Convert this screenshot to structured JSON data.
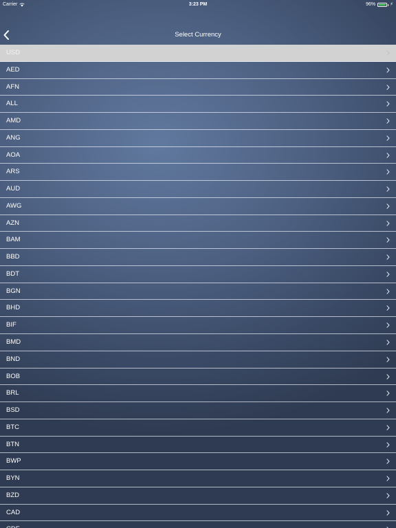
{
  "status_bar": {
    "carrier": "Carrier",
    "time": "3:23 PM",
    "battery": "96%",
    "icons": [
      "wifi-icon",
      "battery-icon",
      "bolt-icon"
    ]
  },
  "nav": {
    "title": "Select Currency",
    "back_icon": "chevron-left-icon"
  },
  "currencies": [
    {
      "code": "USD",
      "selected": true
    },
    {
      "code": "AED"
    },
    {
      "code": "AFN"
    },
    {
      "code": "ALL"
    },
    {
      "code": "AMD"
    },
    {
      "code": "ANG"
    },
    {
      "code": "AOA"
    },
    {
      "code": "ARS"
    },
    {
      "code": "AUD"
    },
    {
      "code": "AWG"
    },
    {
      "code": "AZN"
    },
    {
      "code": "BAM"
    },
    {
      "code": "BBD"
    },
    {
      "code": "BDT"
    },
    {
      "code": "BGN"
    },
    {
      "code": "BHD"
    },
    {
      "code": "BIF"
    },
    {
      "code": "BMD"
    },
    {
      "code": "BND"
    },
    {
      "code": "BOB"
    },
    {
      "code": "BRL"
    },
    {
      "code": "BSD"
    },
    {
      "code": "BTC"
    },
    {
      "code": "BTN"
    },
    {
      "code": "BWP"
    },
    {
      "code": "BYN"
    },
    {
      "code": "BZD"
    },
    {
      "code": "CAD"
    },
    {
      "code": "CDF"
    }
  ],
  "colors": {
    "selected_row": "#d2d2d2",
    "battery_fill": "#4cd964",
    "background_center": "#61799f",
    "background_edge": "#2f3b52"
  }
}
